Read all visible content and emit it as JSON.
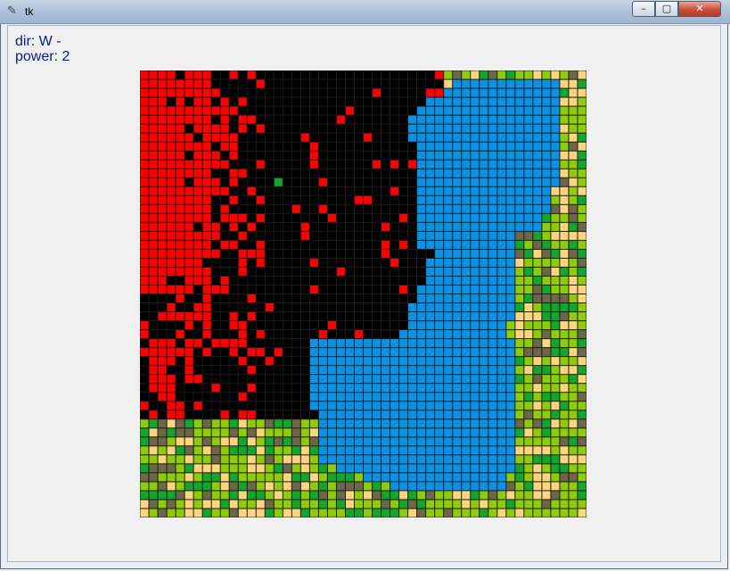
{
  "window": {
    "title": "tk",
    "feather_icon": "feather-icon",
    "minimize_icon": "minimize-icon",
    "maximize_icon": "maximize-icon",
    "close_icon": "close-icon"
  },
  "status": {
    "dir_text": "dir: W -",
    "power_text": "power: 2"
  },
  "board": {
    "columns": 50,
    "rows": 50,
    "grid_line_color": "#1a1a1a",
    "palette": {
      "burnt": "#000000",
      "fire": "#ff0000",
      "water": "#0a93e6",
      "grass": "#8ecb0b",
      "shrub": "#13a52c",
      "sand": "#fed57f",
      "dirt": "#6b6748"
    }
  }
}
